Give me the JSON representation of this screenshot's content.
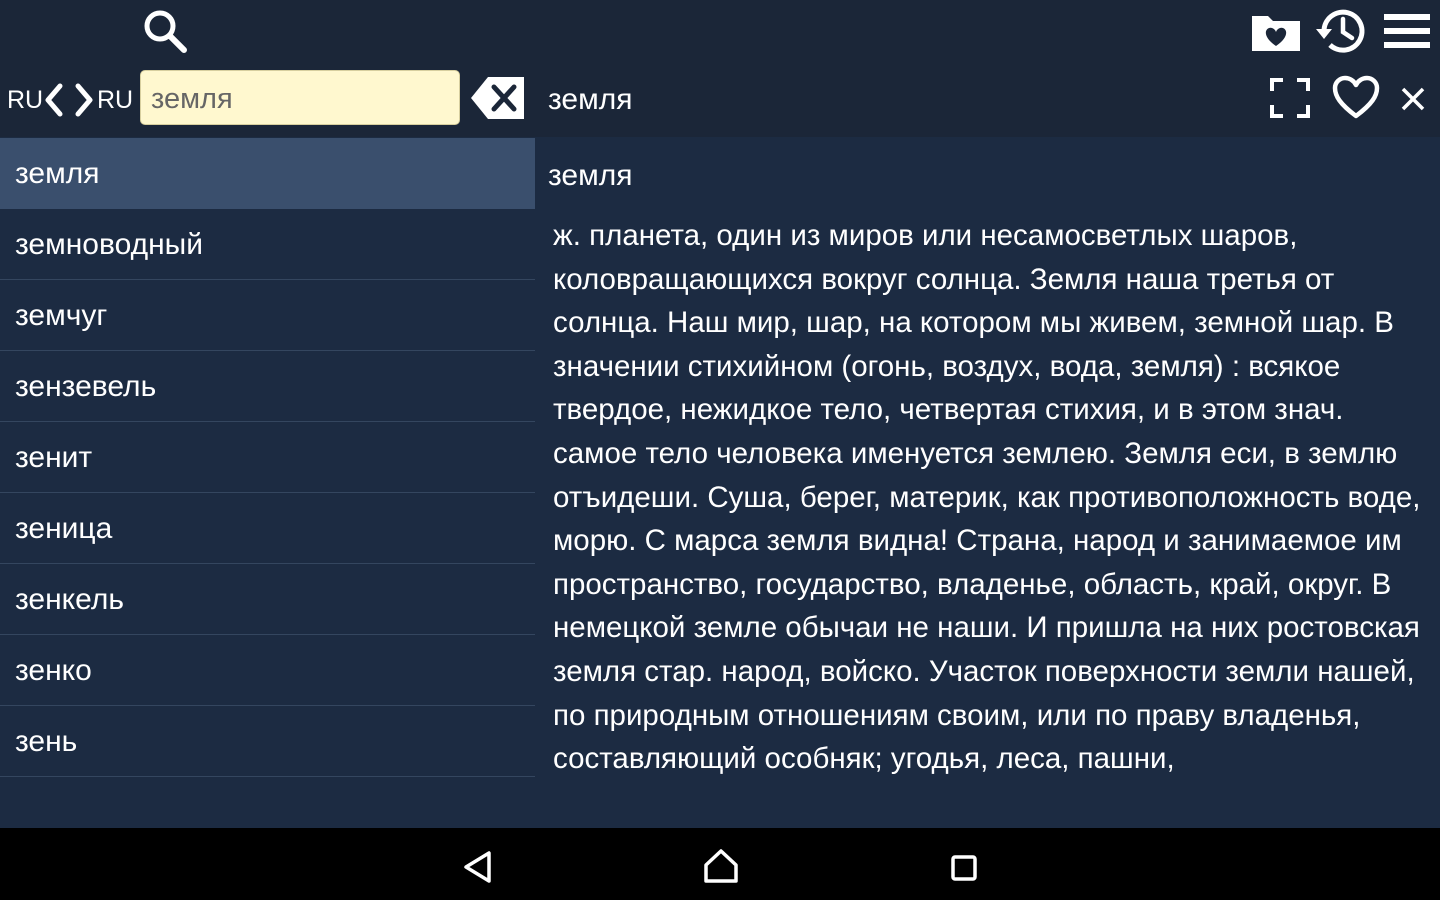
{
  "toolbar": {
    "search_icon": "search-icon",
    "favorites_icon": "heart-folder-icon",
    "history_icon": "history-icon",
    "menu_icon": "hamburger-menu-icon"
  },
  "search_bar": {
    "lang_from": "RU",
    "lang_to": "RU",
    "query": "земля"
  },
  "article_header": {
    "word": "земля"
  },
  "word_list": [
    {
      "word": "земля",
      "selected": true
    },
    {
      "word": "земноводный"
    },
    {
      "word": "земчуг"
    },
    {
      "word": "зензевель"
    },
    {
      "word": "зенит"
    },
    {
      "word": "зеница"
    },
    {
      "word": "зенкель"
    },
    {
      "word": "зенко"
    },
    {
      "word": "зень"
    }
  ],
  "article": {
    "title": "земля",
    "body": "ж. планета, один из миров или несамосветлых шаров, коловращающихся вокруг солнца. Земля наша третья от солнца. Наш мир, шар, на котором мы живем, земной шар. В значении стихийном (огонь, воздух, вода, земля) : всякое твердое, нежидкое тело, четвертая стихия, и в этом знач. самое тело человека именуется землею. Земля еси, в землю отъидеши. Суша, берег, материк, как противоположность воде, морю. С марса земля видна! Страна, народ и занимаемое им пространство, государство, владенье, область, край, округ. В немецкой земле обычаи не наши. И пришла на них ростовская земля стар. народ, войско. Участок поверхности земли нашей, по природным отношениям своим, или по праву владенья, составляющий особняк; угодья, леса, пашни,"
  },
  "colors": {
    "topbar": "#1b2638",
    "background": "#1c2b42",
    "selected_row": "#3a4f6d",
    "search_box": "#fff8cf",
    "navbar": "#000000"
  }
}
